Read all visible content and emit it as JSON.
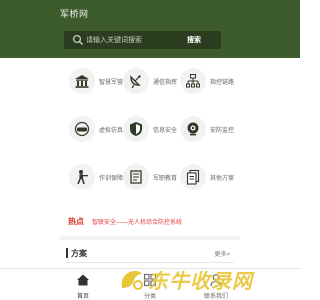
{
  "header": {
    "logo": "军桥网",
    "search_placeholder": "请输入关键词搜索",
    "search_button": "搜索"
  },
  "grid": [
    {
      "label": "智慧军营",
      "icon": "building-icon"
    },
    {
      "label": "通信指挥",
      "icon": "satellite-dish-icon"
    },
    {
      "label": "指控链路",
      "icon": "network-icon"
    },
    {
      "label": "虚拟仿真",
      "icon": "vr-headset-icon"
    },
    {
      "label": "信息安全",
      "icon": "shield-icon"
    },
    {
      "label": "安防监控",
      "icon": "camera-icon"
    },
    {
      "label": "作训保障",
      "icon": "soldier-icon"
    },
    {
      "label": "军职教育",
      "icon": "book-icon"
    },
    {
      "label": "其他方案",
      "icon": "documents-icon"
    }
  ],
  "hot": {
    "title": "热点",
    "text": "智联安全——无人机综合防控系统"
  },
  "plan": {
    "title": "方案",
    "more": "更多>"
  },
  "footer": {
    "items": [
      {
        "label": "首页",
        "icon": "home-icon"
      },
      {
        "label": "分类",
        "icon": "category-icon"
      },
      {
        "label": "联系我们",
        "icon": "contact-icon"
      }
    ]
  },
  "watermark": {
    "text": "东牛收录网"
  },
  "colors": {
    "header_bg": "#3d5c2b",
    "search_bg": "#2a3d1e",
    "hot_red": "#d9352b",
    "watermark_yellow": "#e8c63a",
    "icon_dark": "#2f3a28"
  }
}
